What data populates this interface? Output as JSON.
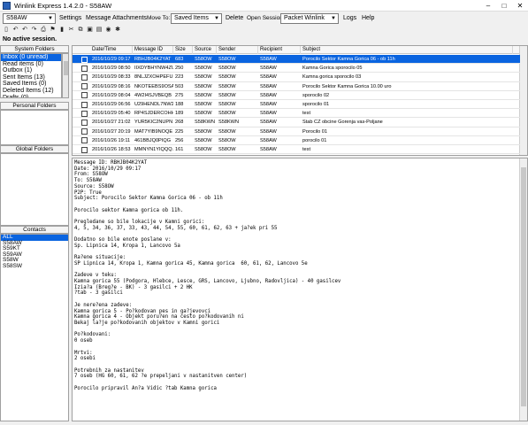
{
  "window": {
    "title": "Winlink Express 1.4.2.0 - S58AW",
    "minimize": "–",
    "maximize": "□",
    "close": "✕"
  },
  "menubar": {
    "callsign": "S58AW",
    "settings": "Settings",
    "message": "Message",
    "attachments": "Attachments",
    "move_to_label": "Move To:",
    "move_to_value": "Saved Items",
    "delete": "Delete",
    "open_session_label": "Open Session:",
    "session_value": "Packet Winlink",
    "logs": "Logs",
    "help": "Help"
  },
  "toolbar": {
    "icons": [
      "new-message-icon",
      "reply-icon",
      "reply-all-icon",
      "forward-icon",
      "print-icon",
      "flag-icon",
      "delete-icon",
      "cut-icon",
      "copy-icon",
      "save-icon",
      "address-book-icon",
      "globe-icon",
      "settings-icon"
    ],
    "glyphs": [
      "▯",
      "↶",
      "↶",
      "↷",
      "⎙",
      "⚑",
      "▮",
      "✂",
      "⧉",
      "▣",
      "▤",
      "◉",
      "✱"
    ]
  },
  "status": "No active session.",
  "sidebar": {
    "system_folders_label": "System Folders",
    "folders": [
      "Inbox (0 unread)",
      "Read items (0)",
      "Outbox (1)",
      "Sent Items (13)",
      "Saved Items (0)",
      "Deleted Items (12)",
      "Drafts (0)"
    ],
    "personal_folders_label": "Personal Folders",
    "global_folders_label": "Global Folders",
    "contacts_label": "Contacts",
    "contacts": [
      "ALL",
      "S58AW",
      "S59KT",
      "S59AW",
      "S58W",
      "S58SW"
    ]
  },
  "message_list": {
    "columns": [
      "Date/Time",
      "Message ID",
      "Size",
      "Source",
      "Sender",
      "Recipient",
      "Subject"
    ],
    "rows": [
      [
        "2016/10/29 09:17",
        "RBHJB04K2YAT",
        "683",
        "S58OW",
        "S58OW",
        "S58AW",
        "Porocilo Sektor Kamna Gorica 06 - ob 11h"
      ],
      [
        "2016/10/29 08:50",
        "IIXDYBHYNW4ZU",
        "250",
        "S58OW",
        "S58OW",
        "S58AW",
        "Kamna Gorica sporocilo 05"
      ],
      [
        "2016/10/29 08:33",
        "8NLJZXOHPEFU",
        "223",
        "S58OW",
        "S58OW",
        "S58AW",
        "Kamna gorica sporocilo 03"
      ],
      [
        "2016/10/29 08:16",
        "NKOTEEBS9OSA",
        "503",
        "S58OW",
        "S58OW",
        "S58AW",
        "Porocilo Sektor Kamna Gorica 10.00 uro"
      ],
      [
        "2016/10/29 08:04",
        "4W2I4SJVBEQB",
        "275",
        "S58OW",
        "S58OW",
        "S58AW",
        "sporocilo 02"
      ],
      [
        "2016/10/29 06:56",
        "U29HENDL7NW2",
        "188",
        "S58OW",
        "S58OW",
        "S58AW",
        "sporocilo 01"
      ],
      [
        "2016/10/29 05:40",
        "RP4SJDERCOHH",
        "189",
        "S58OW",
        "S58OW",
        "S58AW",
        "test"
      ],
      [
        "2016/10/27 21:02",
        "YUR5KIC2NUPN",
        "268",
        "S58KWN",
        "S58KWN",
        "S58AW",
        "Stab CZ obcine Gorenja vas-Poljane"
      ],
      [
        "2016/10/27 20:19",
        "MAT7YIB9NOQE",
        "225",
        "S58OW",
        "S58OW",
        "S58AW",
        "Porocilo 01"
      ],
      [
        "2016/10/26 19:11",
        "461BBJQ0PIQG",
        "256",
        "S58OW",
        "S58OW",
        "S58AW",
        "porocilo 01"
      ],
      [
        "2016/10/26 18:53",
        "MMNYN1YIQQQ...",
        "161",
        "S58OW",
        "S58OW",
        "S58AW",
        "test"
      ]
    ]
  },
  "message_body": "Message ID: RBHJB04K2YAT\nDate: 2016/10/29 09:17\nFrom: S58OW\nTo: S58AW\nSource: S58OW\nP2P: True\nSubject: Porocilo Sektor Kamna Gorica 06 - ob 11h\n\nPorocilo sektor Kamna gorica ob 11h.\n\nPregledane so bile lokacije v Kamni gorici:\n4, 5, 34, 36, 37, 33, 43, 44, 54, 55, 60, 61, 62, 63 + ja?ek pri 55\n\nDodatno so bile enote poslane v:\nSp. Lipnica 14, Kropa 1, Lancovo 5a\n\nRa?ene situacije:\nSP Lipnica 14, Kropa 1, Kamna gorica 45, Kamna gorica  60, 61, 62, Lancovo 5e\n\nZadeve v teku:\nKamna gorica 55 (Podgora, Hlebce, Lesce, GRS, Lancovo, Ljubno, Radovljica) - 40 gasilcev\nIzia?a (Breg?e - BK) - 3 gasilci + 2 HK\n?tab - 3 gasilci\n\nJe nere?ena zadeve:\nKamna gorica 5 - Po?kodovan pes in ga?jevovci\nKamna gorica 4 - Objekt poru?en na cesto po?kodovanih ni\nBekaj la?je po?kodovanih objektov v Kamni gorici\n\nPo?kodovani:\n0 oseb\n\nMrtvi:\n2 osebi\n\nPotrebnih za nastanitev\n7 oseb (HG 60, 61, 62 ?e prepeljani v nastanitven center)\n\nPorocilo pripravil An?a Vidic ?tab Kamna gorica"
}
